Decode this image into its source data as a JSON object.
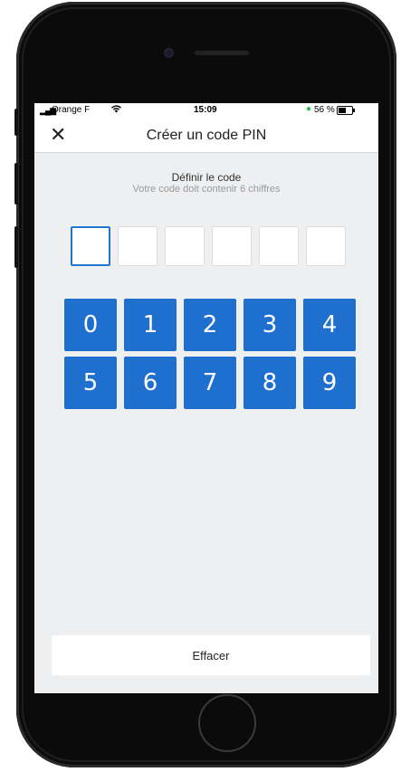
{
  "status_bar": {
    "signal": "▂▄▆",
    "carrier": "Orange F",
    "wifi": "wifi-icon",
    "time": "15:09",
    "battery_dot": "●",
    "battery_percent": "56 %"
  },
  "nav": {
    "close_icon": "✕",
    "title": "Créer un code PIN"
  },
  "pin_header": {
    "title": "Définir le code",
    "subtitle": "Votre code doit contenir 6 chiffres"
  },
  "pin": {
    "length": 6,
    "active_index": 0,
    "values": [
      "",
      "",
      "",
      "",
      "",
      ""
    ]
  },
  "keypad": {
    "row1": [
      "0",
      "1",
      "2",
      "3",
      "4"
    ],
    "row2": [
      "5",
      "6",
      "7",
      "8",
      "9"
    ],
    "key_color": "#1f6fcf"
  },
  "actions": {
    "clear_label": "Effacer"
  }
}
